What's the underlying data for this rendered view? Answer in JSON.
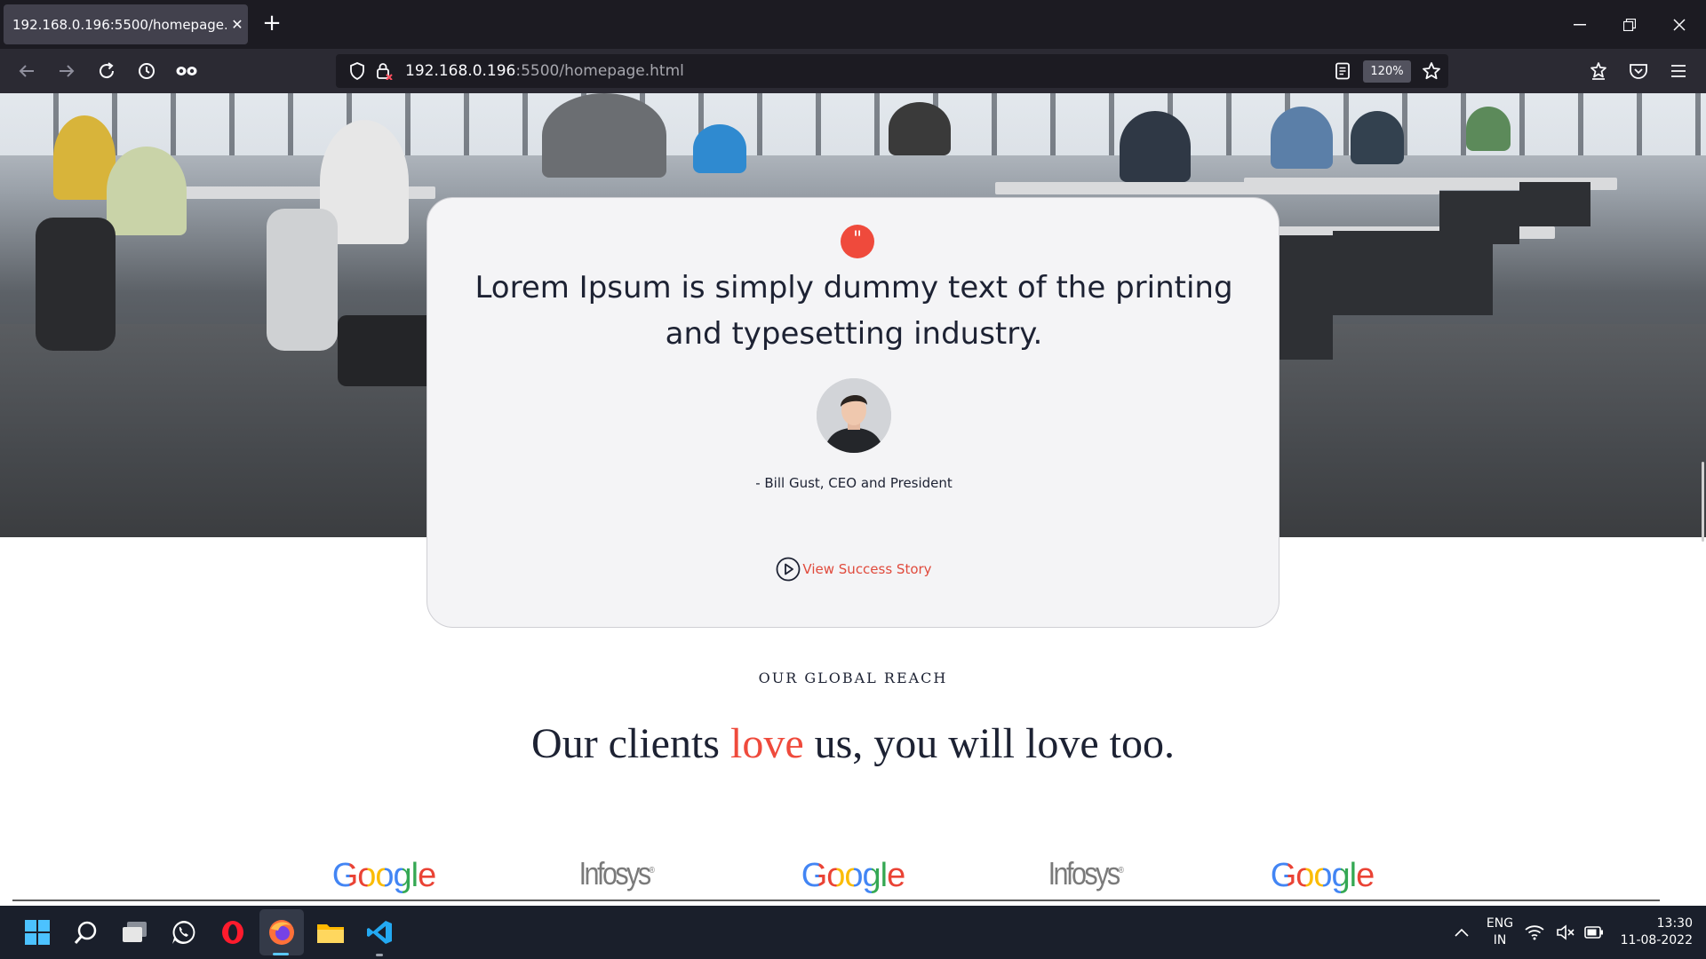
{
  "browser": {
    "tab_title": "192.168.0.196:5500/homepage.html",
    "url_host": "192.168.0.196",
    "url_path": ":5500/homepage.html",
    "zoom": "120%"
  },
  "testimonial": {
    "quote_mark": "\"",
    "quote": "Lorem Ipsum is simply dummy text of the printing and typesetting industry.",
    "author": "- Bill Gust, CEO and President",
    "link_label": "View Success Story"
  },
  "clients": {
    "eyebrow": "OUR GLOBAL REACH",
    "headline_before": "Our clients ",
    "headline_accent": "love",
    "headline_after": " us, you will love too.",
    "logos": [
      "Google",
      "Infosys",
      "Google",
      "Infosys",
      "Google"
    ],
    "infosys_mark": "®"
  },
  "taskbar": {
    "lang_top": "ENG",
    "lang_bottom": "IN",
    "time": "13:30",
    "date": "11-08-2022"
  },
  "colors": {
    "accent": "#ef4a3c",
    "text_dark": "#1d2233",
    "card_bg": "#f4f4f6"
  },
  "icons": [
    "back-arrow-icon",
    "forward-arrow-icon",
    "reload-icon",
    "history-icon",
    "private-mask-icon",
    "shield-icon",
    "lock-warning-icon",
    "reader-view-icon",
    "star-icon",
    "extensions-icon",
    "pocket-icon",
    "menu-icon",
    "play-icon",
    "windows-start-icon",
    "search-icon",
    "task-view-icon",
    "whatsapp-icon",
    "opera-icon",
    "firefox-icon",
    "file-explorer-icon",
    "vscode-icon",
    "chevron-up-icon",
    "wifi-icon",
    "mute-icon",
    "battery-icon"
  ]
}
